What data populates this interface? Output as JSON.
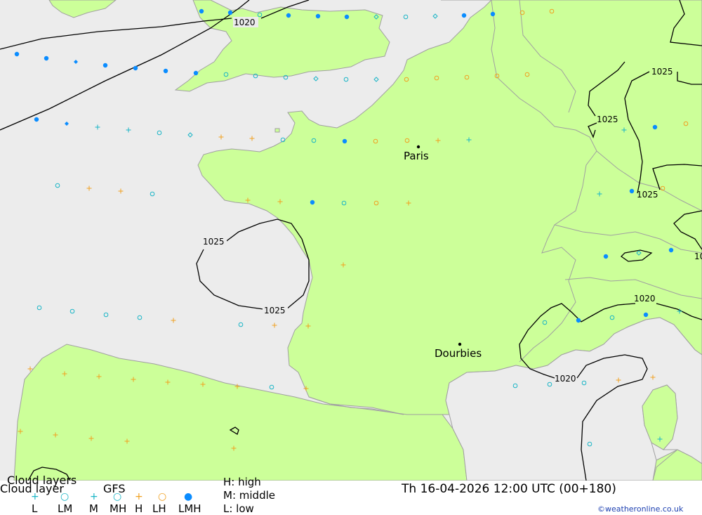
{
  "map": {
    "cities": [
      {
        "name": "Paris"
      },
      {
        "name": "Dourbies"
      }
    ],
    "isobar_labels": [
      "1020",
      "1025",
      "1025",
      "1025",
      "1025",
      "1025",
      "1020",
      "1020",
      "10"
    ],
    "colors": {
      "sea": "#ececec",
      "land": "#ccff99",
      "border": "#a0a0a0",
      "isobar": "#000000",
      "symbol_cyan": "#1ab5c6",
      "symbol_orange": "#f0a020",
      "symbol_blue": "#0a8cff"
    }
  },
  "legend": {
    "title_top": "Cloud layers",
    "title_bottom": "Cloud layer",
    "model": "GFS",
    "symbols": [
      {
        "label": "L",
        "icon": "plus-icon",
        "color": "#1ab5c6"
      },
      {
        "label": "LM",
        "icon": "ring-icon",
        "color": "#1ab5c6"
      },
      {
        "label": "M",
        "icon": "plus-icon",
        "color": "#1ab5c6"
      },
      {
        "label": "MH",
        "icon": "ring-icon",
        "color": "#1ab5c6"
      },
      {
        "label": "H",
        "icon": "plus-icon",
        "color": "#f0a020"
      },
      {
        "label": "LH",
        "icon": "ring-icon",
        "color": "#f0a020"
      },
      {
        "label": "LMH",
        "icon": "filled-circle-icon",
        "color": "#0a8cff"
      }
    ],
    "key_high": "H: high",
    "key_middle": "M: middle",
    "key_low": "L: low",
    "datetime": "Th 16-04-2026 12:00 UTC (00+180)",
    "credit": "©weatheronline.co.uk"
  }
}
